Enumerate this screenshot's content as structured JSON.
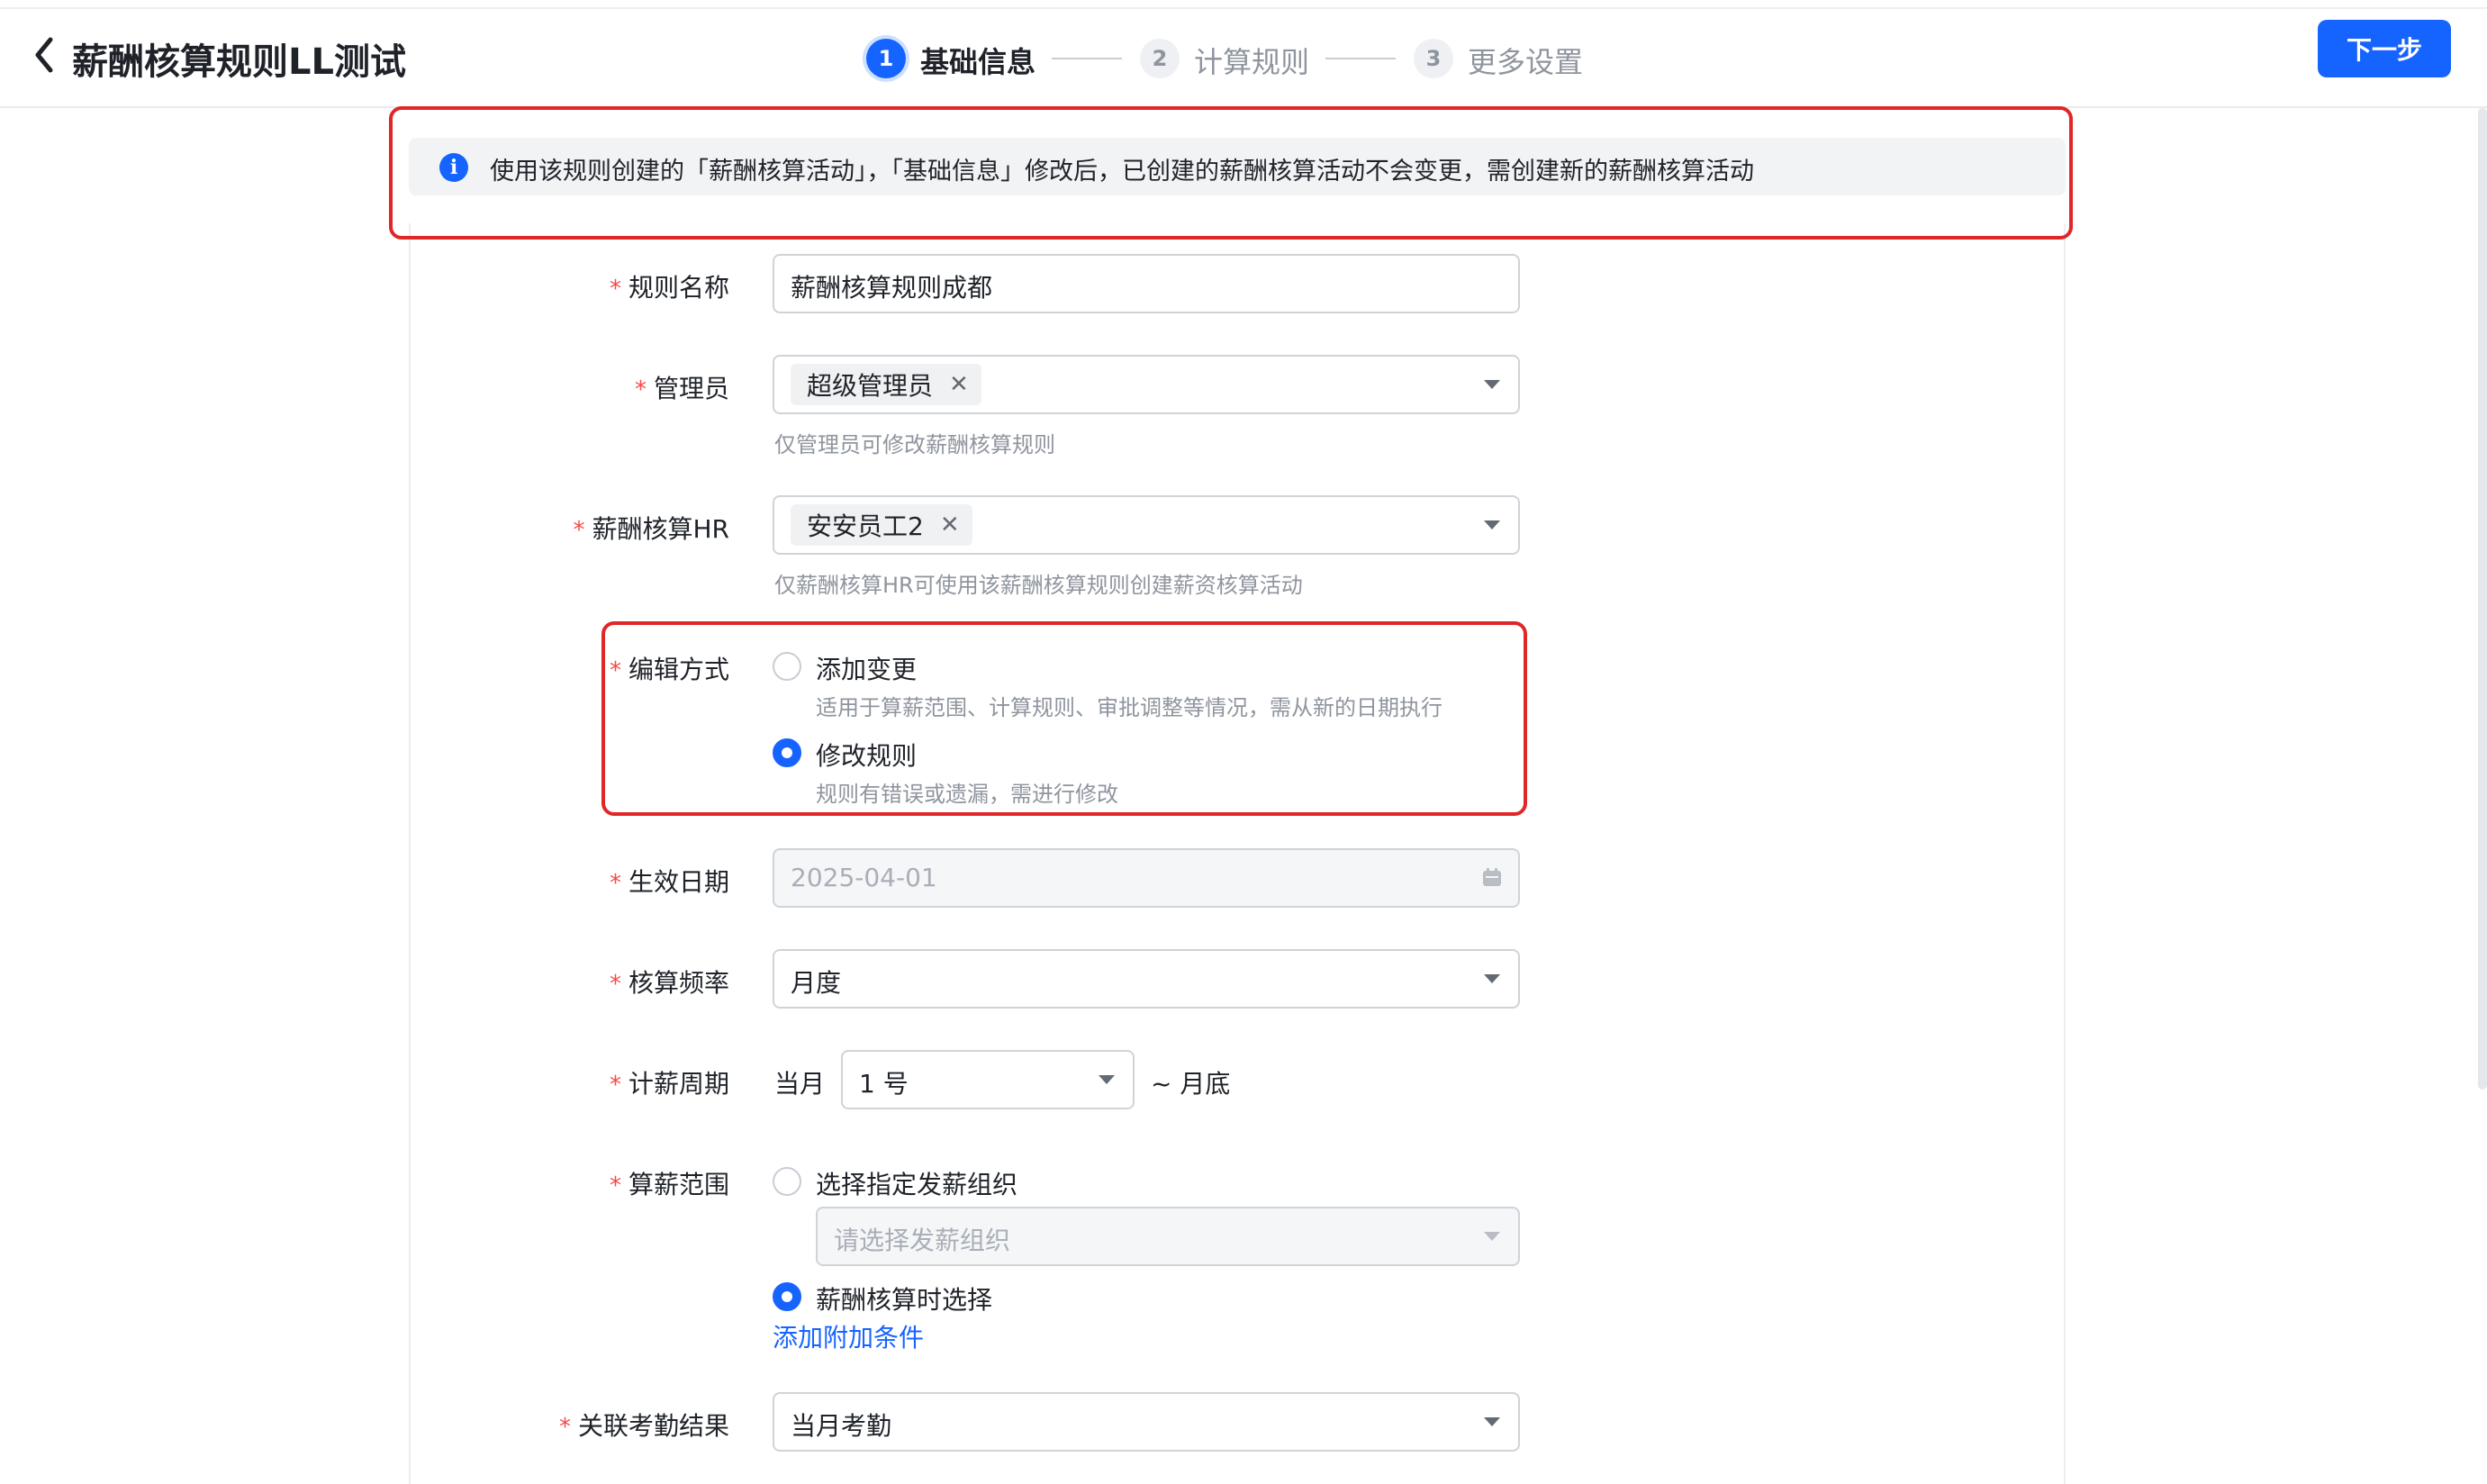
{
  "header": {
    "title": "薪酬核算规则LL测试",
    "steps": [
      {
        "number": "1",
        "label": "基础信息"
      },
      {
        "number": "2",
        "label": "计算规则"
      },
      {
        "number": "3",
        "label": "更多设置"
      }
    ],
    "next_label": "下一步"
  },
  "notice": {
    "text": "使用该规则创建的「薪酬核算活动」，「基础信息」修改后，已创建的薪酬核算活动不会变更，需创建新的薪酬核算活动"
  },
  "required_mark": "*",
  "form": {
    "rule_name": {
      "label": "规则名称",
      "value": "薪酬核算规则成都"
    },
    "admin": {
      "label": "管理员",
      "tag": "超级管理员",
      "hint": "仅管理员可修改薪酬核算规则"
    },
    "hr": {
      "label": "薪酬核算HR",
      "tag": "安安员工2",
      "hint": "仅薪酬核算HR可使用该薪酬核算规则创建薪资核算活动"
    },
    "edit_mode": {
      "label": "编辑方式",
      "options": [
        {
          "label": "添加变更",
          "desc": "适用于算薪范围、计算规则、审批调整等情况，需从新的日期执行",
          "selected": false
        },
        {
          "label": "修改规则",
          "desc": "规则有错误或遗漏，需进行修改",
          "selected": true
        }
      ]
    },
    "effective_date": {
      "label": "生效日期",
      "value": "2025-04-01"
    },
    "frequency": {
      "label": "核算频率",
      "value": "月度"
    },
    "pay_period": {
      "label": "计薪周期",
      "prefix": "当月",
      "value": "1 号",
      "suffix": "~ 月底"
    },
    "scope": {
      "label": "算薪范围",
      "option_specific": {
        "label": "选择指定发薪组织",
        "selected": false,
        "placeholder": "请选择发薪组织"
      },
      "option_runtime": {
        "label": "薪酬核算时选择",
        "selected": true
      },
      "add_condition": "添加附加条件"
    },
    "attendance": {
      "label": "关联考勤结果",
      "value": "当月考勤"
    }
  },
  "colors": {
    "accent": "#1664ff",
    "required": "#f54a45",
    "highlight_box": "#e02626"
  },
  "icons": {
    "back": "chevron-left-icon",
    "info": "info-icon",
    "calendar": "calendar-icon",
    "close": "close-icon",
    "dropdown": "caret-down-icon"
  }
}
